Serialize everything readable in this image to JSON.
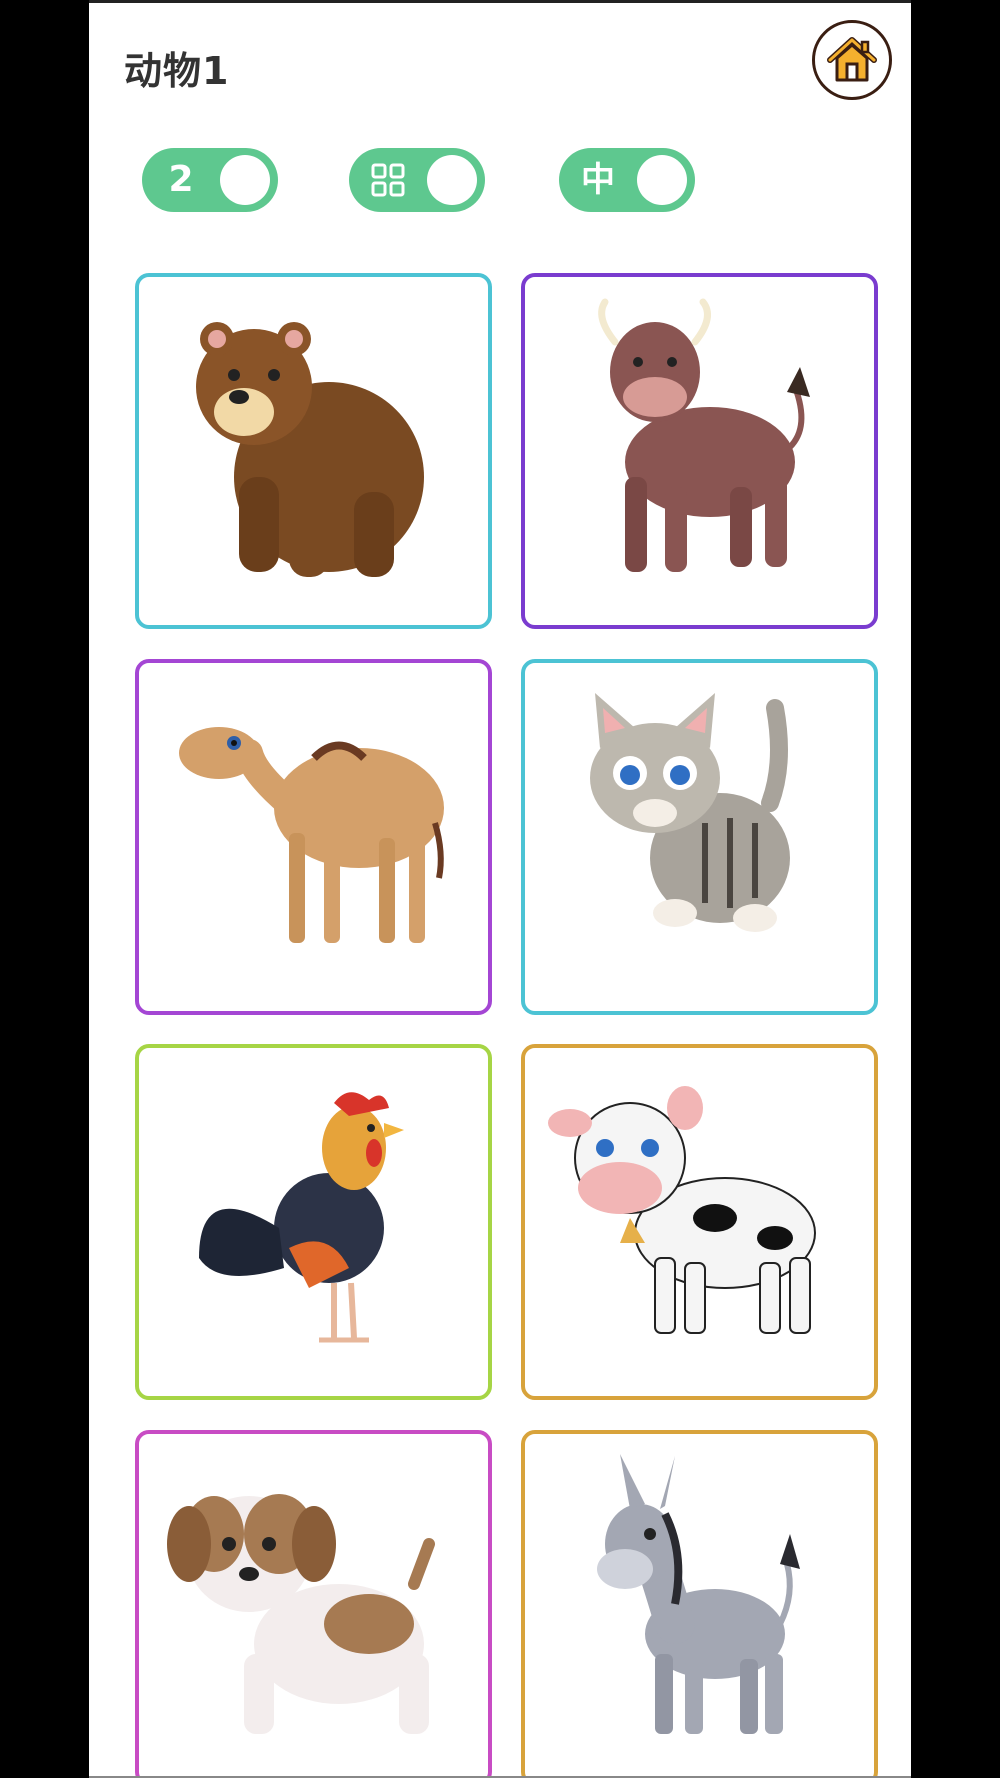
{
  "header": {
    "title": "动物1"
  },
  "controls": {
    "count_toggle_label": "2",
    "lang_toggle_label": "中"
  },
  "icons": {
    "home": "home-icon",
    "grid": "grid-icon"
  },
  "colors": {
    "toggle": "#5ec88f",
    "home_roof": "#f5b02e"
  },
  "cards": [
    {
      "animal": "bear-image",
      "border": "#4cc3d4"
    },
    {
      "animal": "bull-image",
      "border": "#7a3ccf"
    },
    {
      "animal": "camel-image",
      "border": "#a446d4"
    },
    {
      "animal": "cat-image",
      "border": "#4cc3d4"
    },
    {
      "animal": "rooster-image",
      "border": "#a6d545"
    },
    {
      "animal": "cow-image",
      "border": "#d8a33b"
    },
    {
      "animal": "puppy-image",
      "border": "#c84cc4"
    },
    {
      "animal": "donkey-image",
      "border": "#d8a33b"
    }
  ]
}
